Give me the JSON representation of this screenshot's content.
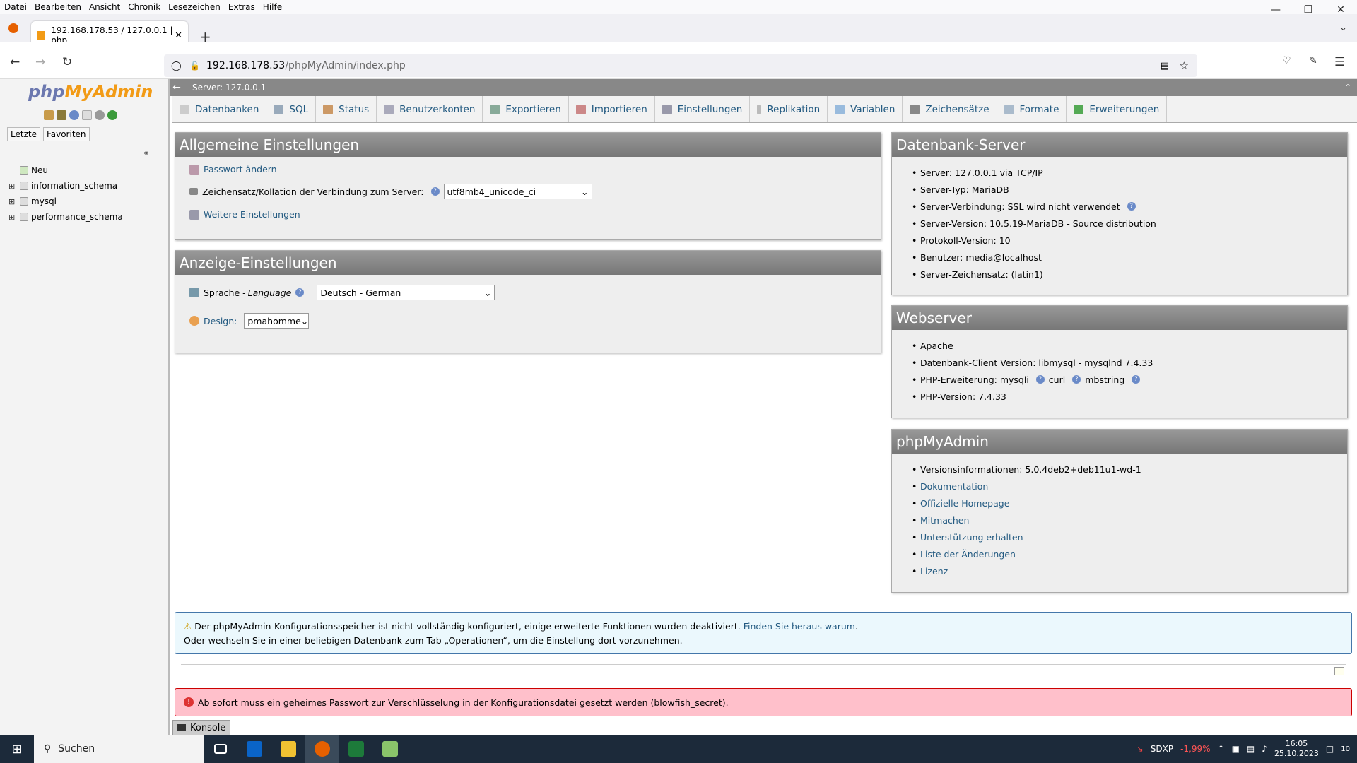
{
  "menubar": [
    "Datei",
    "Bearbeiten",
    "Ansicht",
    "Chronik",
    "Lesezeichen",
    "Extras",
    "Hilfe"
  ],
  "tab": {
    "title": "192.168.178.53 / 127.0.0.1 | php"
  },
  "url": {
    "host": "192.168.178.53",
    "path": "/phpMyAdmin/index.php"
  },
  "sidebar": {
    "logo_php": "php",
    "logo_rest": "MyAdmin",
    "tabs": [
      "Letzte",
      "Favoriten"
    ],
    "tree": [
      "Neu",
      "information_schema",
      "mysql",
      "performance_schema"
    ]
  },
  "topstrip": {
    "server": "Server: 127.0.0.1"
  },
  "pmatabs": [
    "Datenbanken",
    "SQL",
    "Status",
    "Benutzerkonten",
    "Exportieren",
    "Importieren",
    "Einstellungen",
    "Replikation",
    "Variablen",
    "Zeichensätze",
    "Formate",
    "Erweiterungen"
  ],
  "general": {
    "title": "Allgemeine Einstellungen",
    "password": "Passwort ändern",
    "collation_label": "Zeichensatz/Kollation der Verbindung zum Server:",
    "collation_value": "utf8mb4_unicode_ci",
    "more": "Weitere Einstellungen"
  },
  "display": {
    "title": "Anzeige-Einstellungen",
    "language_label": "Sprache - ",
    "language_italic": "Language",
    "language_value": "Deutsch - German",
    "design_label": "Design:",
    "design_value": "pmahomme"
  },
  "dbserver": {
    "title": "Datenbank-Server",
    "items": [
      "Server: 127.0.0.1 via TCP/IP",
      "Server-Typ: MariaDB",
      "Server-Verbindung: SSL wird nicht verwendet",
      "Server-Version: 10.5.19-MariaDB - Source distribution",
      "Protokoll-Version: 10",
      "Benutzer: media@localhost",
      "Server-Zeichensatz: (latin1)"
    ]
  },
  "webserver": {
    "title": "Webserver",
    "items": [
      "Apache",
      "Datenbank-Client Version: libmysql - mysqlnd 7.4.33"
    ],
    "php_ext_label": "PHP-Erweiterung: mysqli",
    "php_ext_curl": "curl",
    "php_ext_mb": "mbstring",
    "php_version": "PHP-Version: 7.4.33"
  },
  "pma": {
    "title": "phpMyAdmin",
    "version": "Versionsinformationen: 5.0.4deb2+deb11u1-wd-1",
    "links": [
      "Dokumentation",
      "Offizielle Homepage",
      "Mitmachen",
      "Unterstützung erhalten",
      "Liste der Änderungen",
      "Lizenz"
    ]
  },
  "notice": {
    "line1": "Der phpMyAdmin-Konfigurationsspeicher ist nicht vollständig konfiguriert, einige erweiterte Funktionen wurden deaktiviert.",
    "link": "Finden Sie heraus warum",
    "line2": "Oder wechseln Sie in einer beliebigen Datenbank zum Tab „Operationen“, um die Einstellung dort vorzunehmen."
  },
  "error": "Ab sofort muss ein geheimes Passwort zur Verschlüsselung in der Konfigurationsdatei gesetzt werden (blowfish_secret).",
  "console": "Konsole",
  "taskbar": {
    "search": "Suchen",
    "stock": "SDXP",
    "stock_change": "-1,99%",
    "time": "16:05",
    "date": "25.10.2023",
    "notif": "10"
  }
}
